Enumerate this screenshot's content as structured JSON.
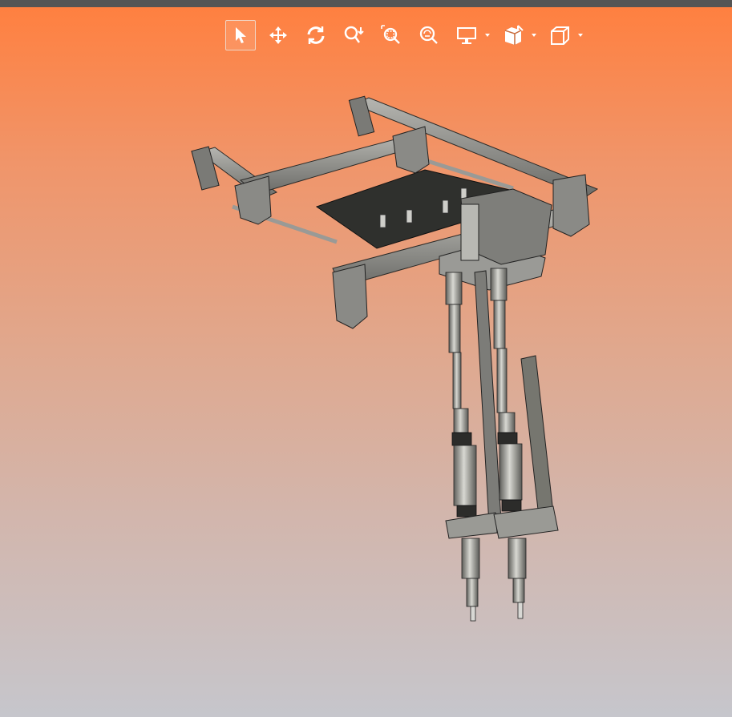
{
  "colors": {
    "window_bar": "#555555",
    "bg_top": "#ff8040",
    "bg_bottom": "#c6c6cc",
    "icon": "#ffffff",
    "metal": "#8c8c88",
    "metal_dark": "#3d3d3a",
    "plate": "#2f302d"
  },
  "toolbar": {
    "buttons": [
      {
        "icon": "select-pointer-icon",
        "active": true
      },
      {
        "icon": "pan-move-icon"
      },
      {
        "icon": "rotate-icon"
      },
      {
        "icon": "zoom-icon"
      },
      {
        "icon": "zoom-window-icon"
      },
      {
        "icon": "zoom-fit-icon"
      }
    ],
    "dropdowns": [
      {
        "icon": "display-monitor-icon",
        "menu": "chevron-down-icon"
      },
      {
        "icon": "section-plane-icon",
        "menu": "chevron-down-icon"
      },
      {
        "icon": "view-cube-icon",
        "menu": "chevron-down-icon"
      }
    ]
  },
  "model": {
    "subject": "cad-assembly-gantry-with-two-spindles"
  }
}
